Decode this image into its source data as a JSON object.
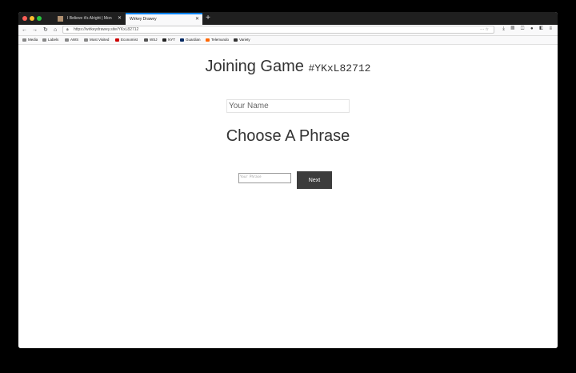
{
  "browser": {
    "tabs": [
      {
        "label": "I Believe it's Alright | Mon"
      },
      {
        "label": "Wirkey Drawey"
      }
    ],
    "new_tab_label": "+",
    "url": "https://wirkeydrawey.site/YKxL82712",
    "bookmarks": [
      "Media",
      "Labels",
      "AWS",
      "Most Visited",
      "Economist",
      "WSJ",
      "NYT",
      "Guardian",
      "Telemundo",
      "Variety"
    ]
  },
  "page": {
    "title": "Joining Game",
    "game_code": "#YKxL82712",
    "name_placeholder": "Your Name",
    "subtitle": "Choose A Phrase",
    "phrase_placeholder": "Your Phrase",
    "next_label": "Next"
  }
}
